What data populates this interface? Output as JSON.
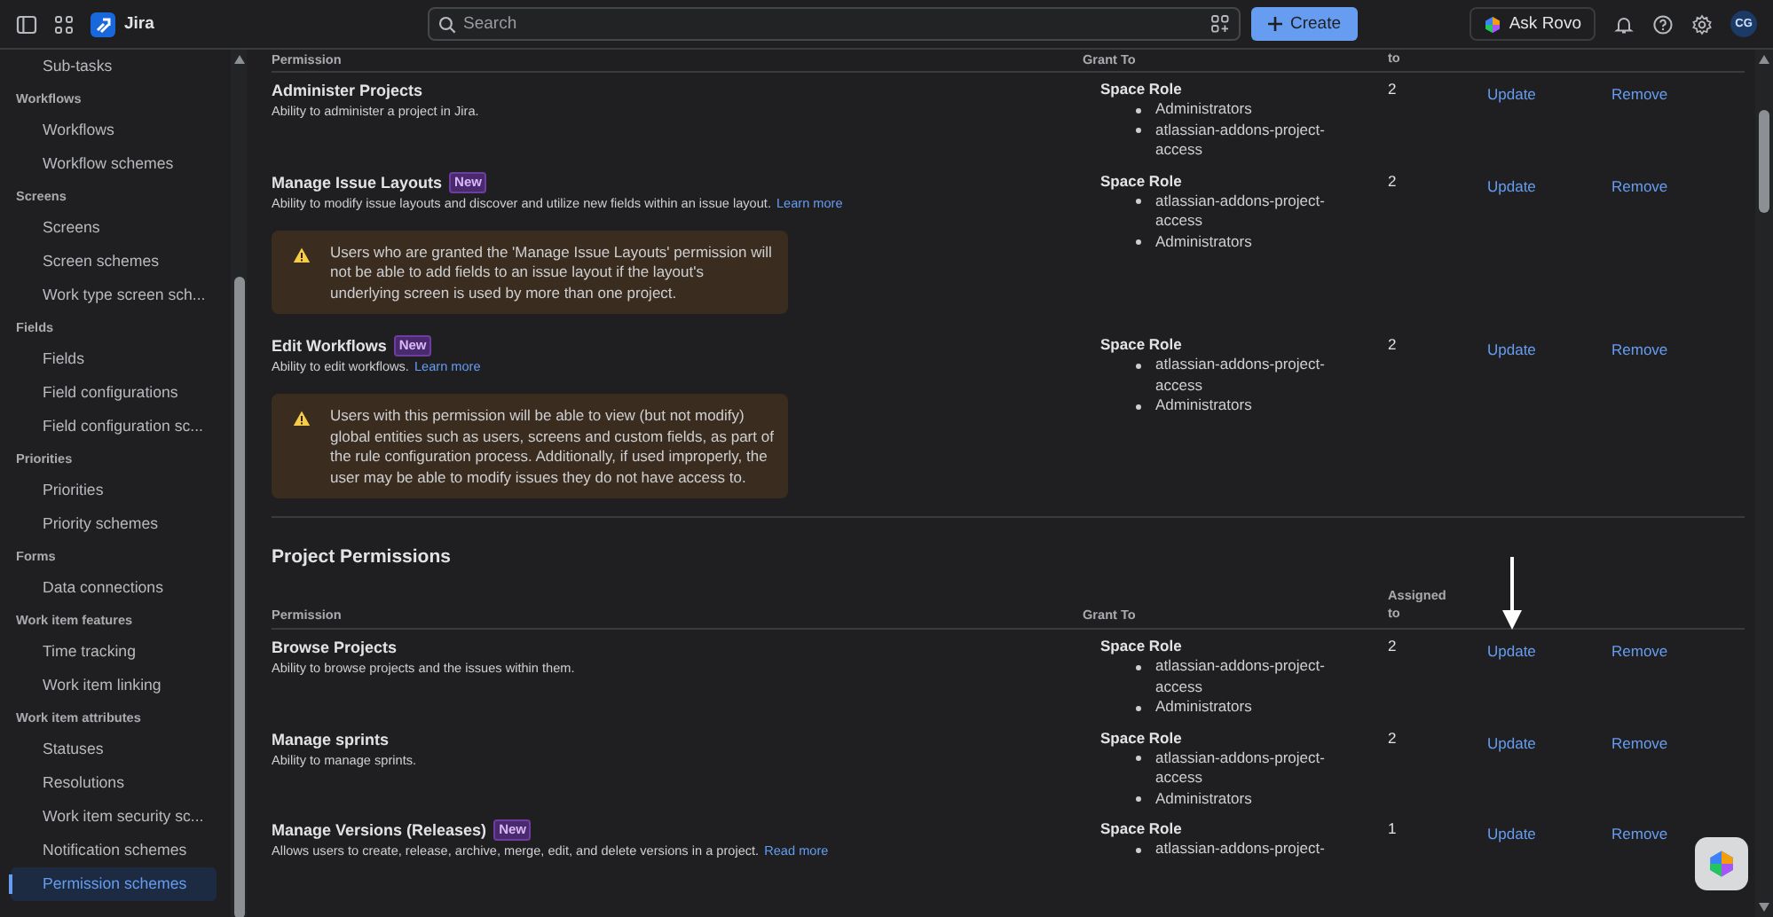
{
  "topbar": {
    "app_name": "Jira",
    "search": {
      "placeholder": "Search"
    },
    "create_button": "Create",
    "ask_button": "Ask Rovo",
    "avatar": "CG"
  },
  "sidebar": {
    "sections": [
      {
        "items": [
          {
            "label": "Sub-tasks",
            "selected": false
          }
        ]
      },
      {
        "heading": "Workflows",
        "items": [
          {
            "label": "Workflows",
            "selected": false
          },
          {
            "label": "Workflow schemes",
            "selected": false
          }
        ]
      },
      {
        "heading": "Screens",
        "items": [
          {
            "label": "Screens",
            "selected": false
          },
          {
            "label": "Screen schemes",
            "selected": false
          },
          {
            "label": "Work type screen sch...",
            "selected": false
          }
        ]
      },
      {
        "heading": "Fields",
        "items": [
          {
            "label": "Fields",
            "selected": false
          },
          {
            "label": "Field configurations",
            "selected": false
          },
          {
            "label": "Field configuration sc...",
            "selected": false
          }
        ]
      },
      {
        "heading": "Priorities",
        "items": [
          {
            "label": "Priorities",
            "selected": false
          },
          {
            "label": "Priority schemes",
            "selected": false
          }
        ]
      },
      {
        "heading": "Forms",
        "items": [
          {
            "label": "Data connections",
            "selected": false
          }
        ]
      },
      {
        "heading": "Work item features",
        "items": [
          {
            "label": "Time tracking",
            "selected": false
          },
          {
            "label": "Work item linking",
            "selected": false
          }
        ]
      },
      {
        "heading": "Work item attributes",
        "items": [
          {
            "label": "Statuses",
            "selected": false
          },
          {
            "label": "Resolutions",
            "selected": false
          },
          {
            "label": "Work item security sc...",
            "selected": false
          },
          {
            "label": "Notification schemes",
            "selected": false
          },
          {
            "label": "Permission schemes",
            "selected": true
          }
        ]
      }
    ]
  },
  "permission_sections": [
    {
      "columns": [
        "Permission",
        "Grant To",
        "to"
      ],
      "rows": [
        {
          "name": "Administer Projects",
          "description": "Ability to administer a project in Jira.",
          "grant": {
            "role": "Space Role",
            "members": [
              "Administrators",
              "atlassian-addons-project-access"
            ]
          },
          "assigned": "2",
          "actions": [
            "Update",
            "Remove"
          ]
        },
        {
          "name": "Manage Issue Layouts",
          "badge": "New",
          "description": "Ability to modify issue layouts and discover and utilize new fields within an issue layout.",
          "link": "Learn more",
          "warning": "Users who are granted the 'Manage Issue Layouts' permission will not be able to add fields to an issue layout if the layout's underlying screen is used by more than one project.",
          "grant": {
            "role": "Space Role",
            "members": [
              "atlassian-addons-project-access",
              "Administrators"
            ]
          },
          "assigned": "2",
          "actions": [
            "Update",
            "Remove"
          ]
        },
        {
          "name": "Edit Workflows",
          "badge": "New",
          "description": "Ability to edit workflows.",
          "link": "Learn more",
          "warning": "Users with this permission will be able to view (but not modify) global entities such as users, screens and custom fields, as part of the rule configuration process. Additionally, if used improperly, the user may be able to modify issues they do not have access to.",
          "grant": {
            "role": "Space Role",
            "members": [
              "atlassian-addons-project-access",
              "Administrators"
            ]
          },
          "assigned": "2",
          "actions": [
            "Update",
            "Remove"
          ]
        }
      ]
    },
    {
      "heading": "Project Permissions",
      "columns": [
        "Permission",
        "Grant To",
        "Assigned to"
      ],
      "rows": [
        {
          "name": "Browse Projects",
          "description": "Ability to browse projects and the issues within them.",
          "grant": {
            "role": "Space Role",
            "members": [
              "atlassian-addons-project-access",
              "Administrators"
            ]
          },
          "assigned": "2",
          "actions": [
            "Update",
            "Remove"
          ]
        },
        {
          "name": "Manage sprints",
          "description": "Ability to manage sprints.",
          "grant": {
            "role": "Space Role",
            "members": [
              "atlassian-addons-project-access",
              "Administrators"
            ]
          },
          "assigned": "2",
          "actions": [
            "Update",
            "Remove"
          ]
        },
        {
          "name": "Manage Versions (Releases)",
          "badge": "New",
          "description": "Allows users to create, release, archive, merge, edit, and delete versions in a project.",
          "link": "Read more",
          "grant": {
            "role": "Space Role",
            "members": [
              "atlassian-addons-project-"
            ]
          },
          "assigned": "1",
          "actions": [
            "Update",
            "Remove"
          ]
        }
      ]
    }
  ]
}
